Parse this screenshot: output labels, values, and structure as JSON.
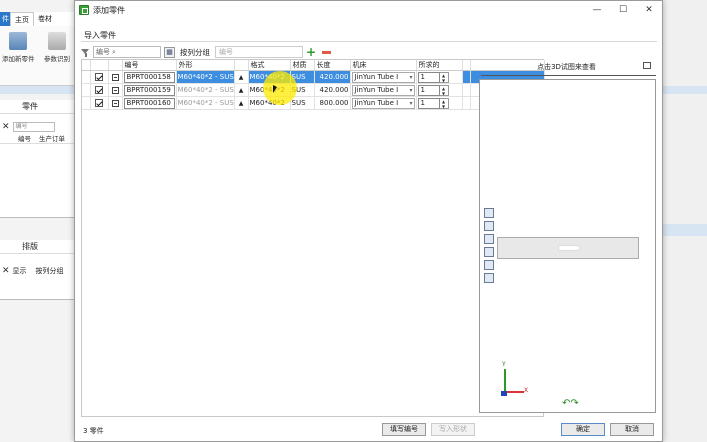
{
  "background_app": {
    "file_tab": "件",
    "tabs": [
      "主页",
      "卷材"
    ],
    "ribbon": {
      "add_part": "添加新零件",
      "param": "参数识别"
    },
    "panel_parts": {
      "title": "零件",
      "search_placeholder": "编号",
      "col1": "编号",
      "col2": "生产订单"
    },
    "panel_layout": {
      "title": "排版",
      "show_label": "显示",
      "group_label": "按列分组"
    }
  },
  "dialog": {
    "title": "添加零件",
    "win": {
      "min": "—",
      "max": "☐",
      "close": "✕"
    },
    "section_title": "导入零件",
    "toolbar": {
      "search_placeholder": "编号",
      "group_label": "按列分组",
      "filter_placeholder": "编号"
    },
    "table": {
      "headers": [
        "编号",
        "外形",
        "",
        "格式",
        "材质",
        "长度",
        "机床",
        "所求的"
      ],
      "rows": [
        {
          "id": "BPRT000158",
          "shape": "M60*40*2 - SUS",
          "format": "M60*40*2",
          "material": "SUS",
          "length": "420.000",
          "machine": "JinYun Tube I",
          "qty": "1",
          "checked": true,
          "selected": true
        },
        {
          "id": "BPRT000159",
          "shape": "M60*40*2 - SUS",
          "format": "M60*40*2",
          "material": "SUS",
          "length": "420.000",
          "machine": "JinYun Tube I",
          "qty": "1",
          "checked": true,
          "selected": false
        },
        {
          "id": "BPRT000160",
          "shape": "M60*40*2 - SUS",
          "format": "M60*40*2",
          "material": "SUS",
          "length": "800.000",
          "machine": "JinYun Tube I",
          "qty": "1",
          "checked": true,
          "selected": false
        }
      ]
    },
    "viewer": {
      "header": "点击3D试图来查看",
      "axis_y": "Y",
      "axis_x": "X"
    },
    "footer": {
      "count_label": "3 零件",
      "fill_number_button": "填写编号",
      "import_shape_button": "写入形状",
      "ok_button": "确定",
      "cancel_button": "取消"
    }
  }
}
